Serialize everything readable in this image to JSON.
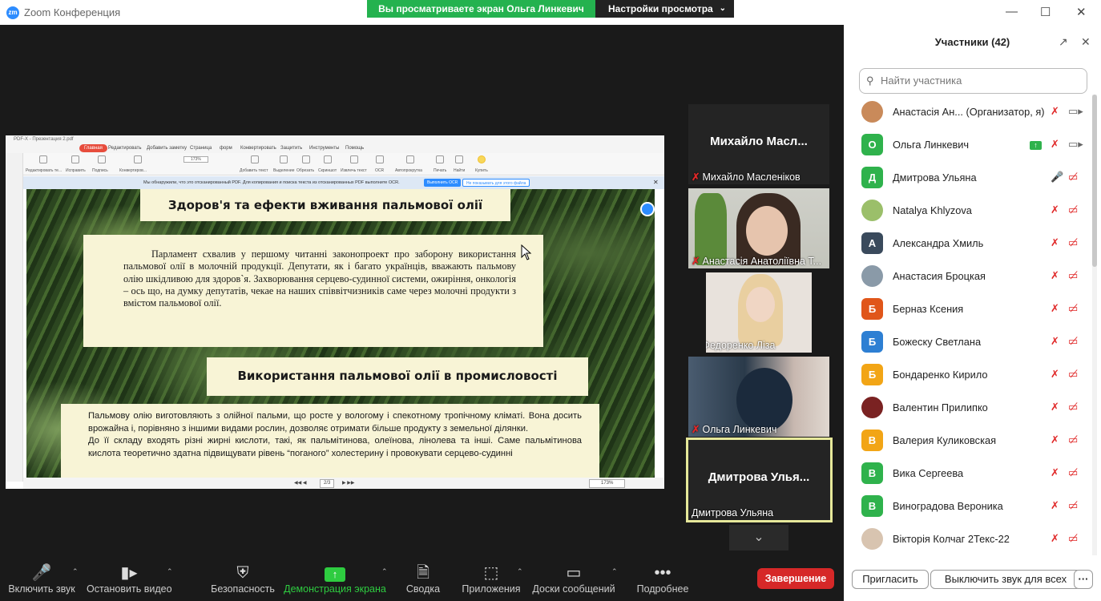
{
  "app": {
    "title": "Zoom Конференция",
    "logo": "zm"
  },
  "banner": {
    "viewing": "Вы просматриваете экран Ольга Линкевич",
    "view_settings": "Настройки просмотра"
  },
  "pdf": {
    "file": "PDF-X - Презентация 2.pdf",
    "menu": [
      "Главная",
      "Редактировать",
      "Добавить заметку",
      "Страница",
      "форм",
      "Конвертировать",
      "Защитить",
      "Инструменты",
      "Помощь"
    ],
    "tools": [
      "Редактировать те...",
      "Исправить",
      "Подпись",
      "Конвертиров...",
      "Добавить текст",
      "Выделение",
      "Обрезать",
      "Скриншот",
      "Извлечь текст",
      "OCR",
      "Автопрокрутка",
      "Печать",
      "Найти",
      "Купить"
    ],
    "zoom": "173%",
    "ocr_message": "Мы обнаружили, что это отсканированный PDF. Для копирования и поиска текста из отсканированных PDF выполните OCR.",
    "ocr_button": "Выполнить OCR",
    "ocr_hide": "Не показывать для этого файла",
    "page": "2/3",
    "slide": {
      "heading1": "Здоров'я та ефекти вживання пальмової олії",
      "para1": "Парламент схвалив у першому читанні законопроект про заборону використання пальмової олії в молочній продукції. Депутати, як і багато українців, вважають пальмову олію шкідливою для здоров`я. Захворювання серцево-судинної системи, ожиріння, онкологія – ось що, на думку депутатів, чекае на наших співвітчизників саме через молочні продукти з вмістом пальмової олії.",
      "heading2": "Використання пальмової олії в промисловості",
      "para2a": "Пальмову олію виготовляють з олійної пальми, що росте у вологому і спекотному тропічному кліматі. Вона досить врожайна і, порівняно з іншими видами рослин, дозволяє отримати більше продукту з земельної ділянки.",
      "para2b": "До її складу входять різні жирні кислоти, такі, як пальмітинова, олеїнова, лінолева та інші. Саме пальмітинова кислота теоретично здатна підвищувати рівень “поганого” холестерину і провокувати серцево-судинні"
    }
  },
  "gallery": [
    {
      "big": "Михайло  Масл...",
      "label": "Михайло Масленіков"
    },
    {
      "label": "Анастасія Анатоліївна Т..."
    },
    {
      "label": "Федоренко Ліза"
    },
    {
      "label": "Ольга Линкевич"
    },
    {
      "big": "Дмитрова  Улья...",
      "label": "Дмитрова Ульяна"
    }
  ],
  "participants": {
    "title": "Участники (42)",
    "search_placeholder": "Найти участника",
    "list": [
      {
        "name": "Анастасія Ан...   (Организатор, я)",
        "avatar": "",
        "color": "#c98a5a",
        "mic": "muted",
        "cam": "on"
      },
      {
        "name": "Ольга Линкевич",
        "avatar": "О",
        "color": "#2fb24c",
        "mic": "muted",
        "cam": "on",
        "sharing": true
      },
      {
        "name": "Дмитрова Ульяна",
        "avatar": "Д",
        "color": "#2fb24c",
        "mic": "on",
        "cam": "off"
      },
      {
        "name": "Natalya Khlyzova",
        "avatar": "",
        "color": "#9bbf6a",
        "mic": "muted",
        "cam": "off"
      },
      {
        "name": "Александра Хмиль",
        "avatar": "А",
        "color": "#3a4a5c",
        "mic": "muted",
        "cam": "off"
      },
      {
        "name": "Анастасия Броцкая",
        "avatar": "",
        "color": "#8a9aa8",
        "mic": "muted",
        "cam": "off"
      },
      {
        "name": "Берназ Ксения",
        "avatar": "Б",
        "color": "#e0561a",
        "mic": "muted",
        "cam": "off"
      },
      {
        "name": "Божеску Светлана",
        "avatar": "Б",
        "color": "#2d7fd3",
        "mic": "muted",
        "cam": "off"
      },
      {
        "name": "Бондаренко Кирило",
        "avatar": "Б",
        "color": "#f2a516",
        "mic": "muted",
        "cam": "off"
      },
      {
        "name": "Валентин Прилипко",
        "avatar": "",
        "color": "#7a2222",
        "mic": "muted",
        "cam": "off"
      },
      {
        "name": "Валерия Куликовская",
        "avatar": "В",
        "color": "#f2a516",
        "mic": "muted",
        "cam": "off"
      },
      {
        "name": "Вика Сергеева",
        "avatar": "В",
        "color": "#2fb24c",
        "mic": "muted",
        "cam": "off"
      },
      {
        "name": "Виноградова Вероника",
        "avatar": "В",
        "color": "#2fb24c",
        "mic": "muted",
        "cam": "off"
      },
      {
        "name": "Вікторія Колчаг 2Текс-22",
        "avatar": "",
        "color": "#d8c4b0",
        "mic": "muted",
        "cam": "off"
      }
    ],
    "invite": "Пригласить",
    "mute_all": "Выключить звук для всех",
    "more": "···"
  },
  "toolbar": {
    "mute": "Включить звук",
    "video": "Остановить видео",
    "security": "Безопасность",
    "share": "Демонстрация экрана",
    "summary": "Сводка",
    "apps": "Приложения",
    "whiteboards": "Доски сообщений",
    "more": "Подробнее",
    "end": "Завершение"
  }
}
